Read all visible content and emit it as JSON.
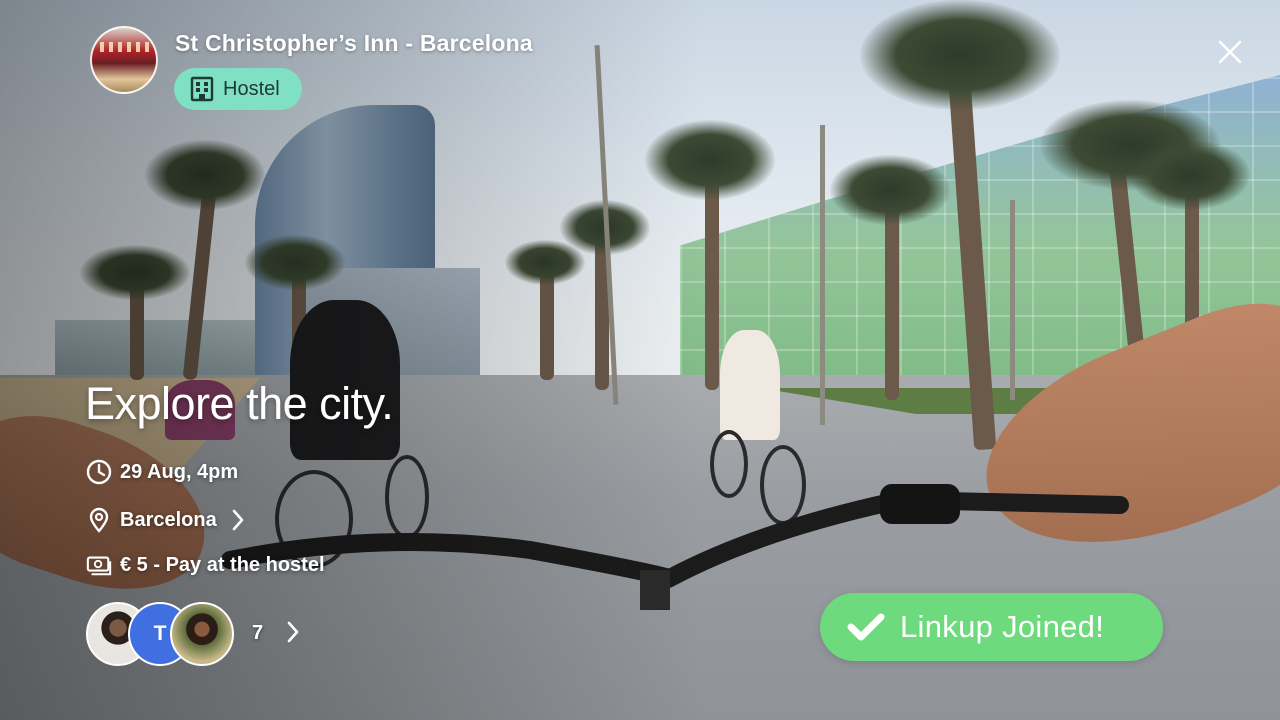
{
  "venue": {
    "name": "St Christopher’s Inn - Barcelona",
    "type_label": "Hostel",
    "type_icon": "building-icon",
    "pill_color": "#7fe0c4"
  },
  "event": {
    "title": "Explore the city.",
    "datetime": "29 Aug, 4pm",
    "location": "Barcelona",
    "price": "€ 5 - Pay at the hostel"
  },
  "attendees": {
    "initial": "T",
    "more_count": "7",
    "avatar_color": "#3f6fe0"
  },
  "action": {
    "joined_label": "Linkup Joined!",
    "color": "#6ddb7d"
  }
}
